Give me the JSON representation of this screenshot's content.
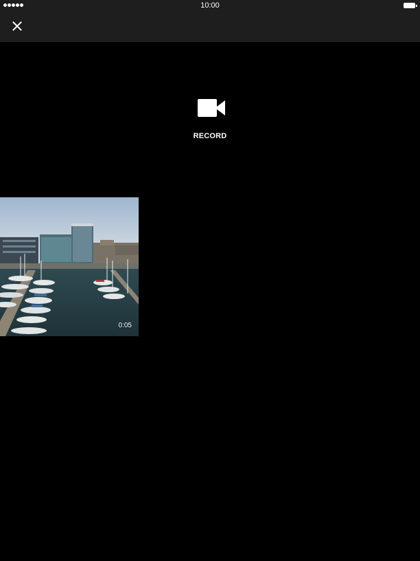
{
  "status_bar": {
    "time": "10:00",
    "signal_icon": "signal-dots-icon",
    "battery_icon": "battery-icon"
  },
  "toolbar": {
    "close_icon": "close-icon"
  },
  "record": {
    "label": "RECORD",
    "icon": "video-camera-icon"
  },
  "videos": [
    {
      "duration": "0:05",
      "thumbnail": "marina-harbor-thumbnail"
    }
  ],
  "colors": {
    "background": "#000000",
    "bar_background": "#1e1e1e",
    "text": "#ffffff"
  }
}
